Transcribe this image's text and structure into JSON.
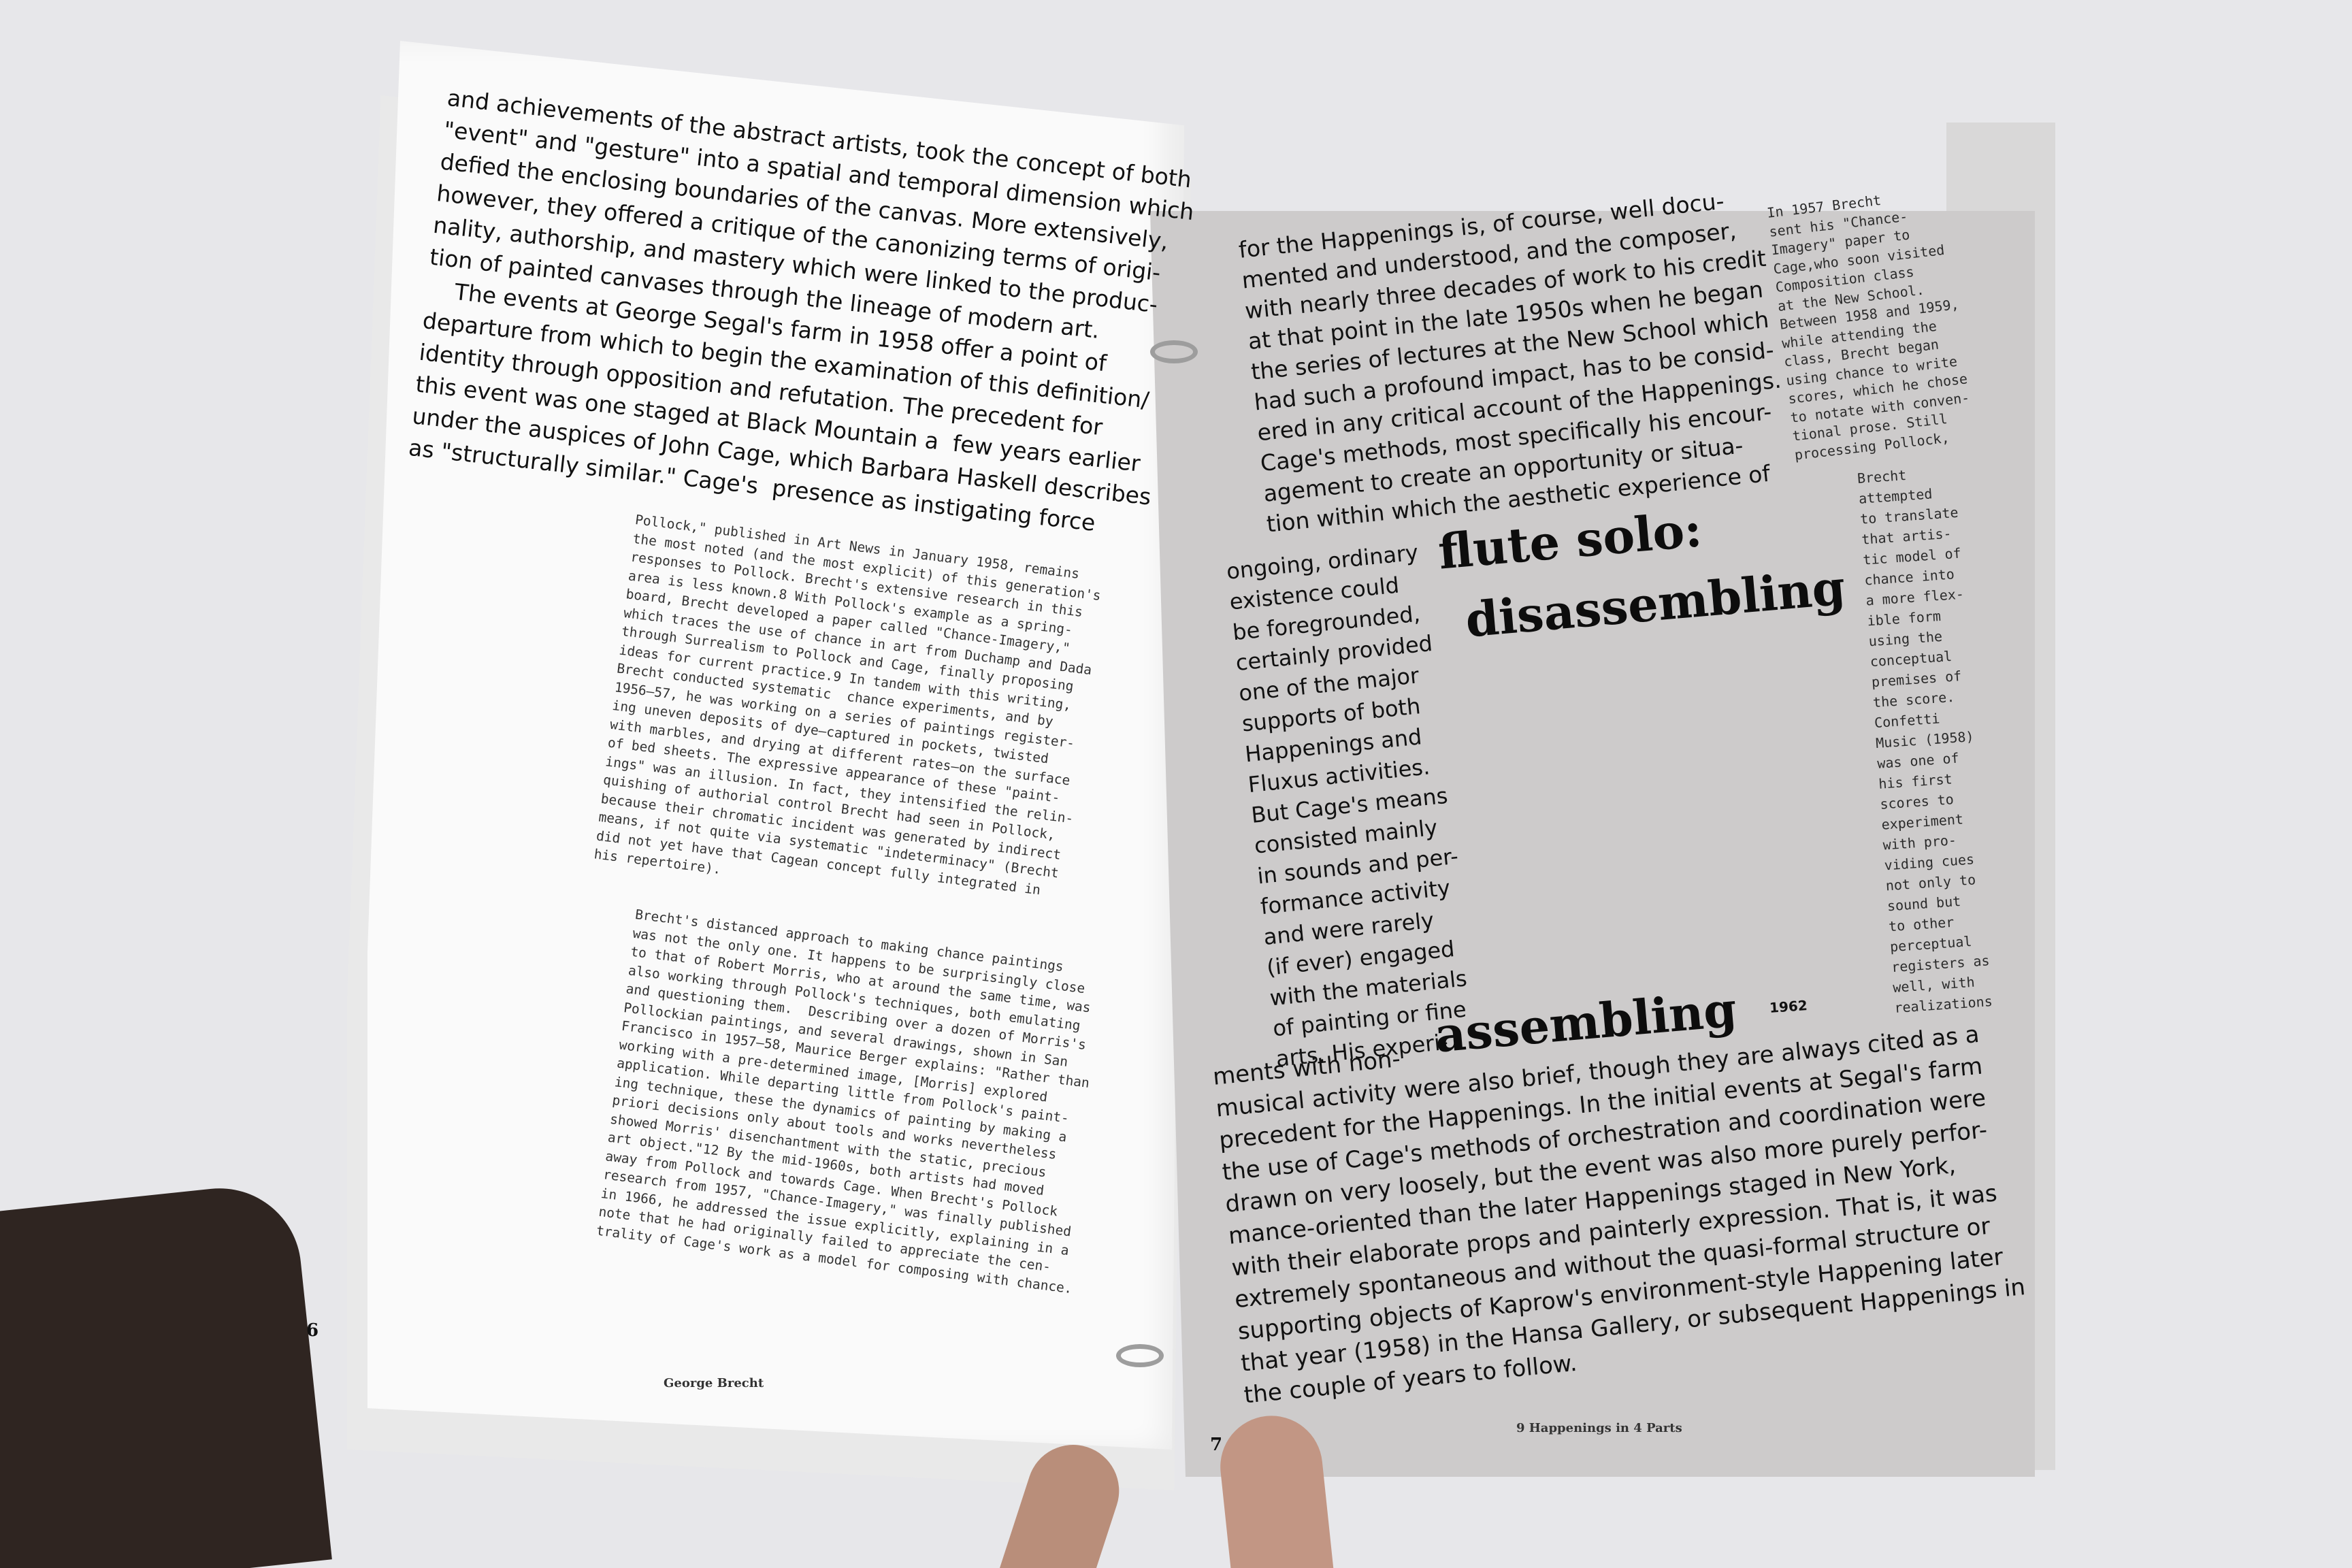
{
  "left_page": {
    "body_lines": [
      "and achievements of the abstract artists, took the concept of both",
      "\"event\" and \"gesture\" into a spatial and temporal dimension which",
      "defied the enclosing boundaries of the canvas. More extensively,",
      "however, they offered a critique of the canonizing terms of origi-",
      "nality, authorship, and mastery which were linked to the produc-",
      "tion of painted canvases through the lineage of modern art.",
      "    The events at George Segal's farm in 1958 offer a point of",
      "departure from which to begin the examination of this definition/",
      "identity through opposition and refutation. The precedent for",
      "this event was one staged at Black Mountain a  few years earlier",
      "under the auspices of John Cage, which Barbara Haskell describes",
      "as \"structurally similar.\" Cage's  presence as instigating force"
    ],
    "mono_block_1": [
      "Pollock,\" published in Art News in January 1958, remains",
      "the most noted (and the most explicit) of this generation's",
      "responses to Pollock. Brecht's extensive research in this",
      "area is less known.8 With Pollock's example as a spring-",
      "board, Brecht developed a paper called \"Chance-Imagery,\"",
      "which traces the use of chance in art from Duchamp and Dada",
      "through Surrealism to Pollock and Cage, finally proposing",
      "ideas for current practice.9 In tandem with this writing,",
      "Brecht conducted systematic  chance experiments, and by",
      "1956–57, he was working on a series of paintings register-",
      "ing uneven deposits of dye–captured in pockets, twisted",
      "with marbles, and drying at different rates–on the surface",
      "of bed sheets. The expressive appearance of these \"paint-",
      "ings\" was an illusion. In fact, they intensified the relin-",
      "quishing of authorial control Brecht had seen in Pollock,",
      "because their chromatic incident was generated by indirect",
      "means, if not quite via systematic \"indeterminacy\" (Brecht",
      "did not yet have that Cagean concept fully integrated in",
      "his repertoire)."
    ],
    "mono_block_2": [
      "Brecht's distanced approach to making chance paintings",
      "was not the only one. It happens to be surprisingly close",
      "to that of Robert Morris, who at around the same time, was",
      "also working through Pollock's techniques, both emulating",
      "and questioning them.  Describing over a dozen of Morris's",
      "Pollockian paintings, and several drawings, shown in San",
      "Francisco in 1957–58, Maurice Berger explains: \"Rather than",
      "working with a pre-determined image, [Morris] explored",
      "application. While departing little from Pollock's paint-",
      "ing technique, these the dynamics of painting by making a",
      "priori decisions only about tools and works nevertheless",
      "showed Morris' disenchantment with the static, precious",
      "art object.\"12 By the mid-1960s, both artists had moved",
      "away from Pollock and towards Cage. When Brecht's Pollock",
      "research from 1957, \"Chance-Imagery,\" was finally published",
      "in 1966, he addressed the issue explicitly, explaining in a",
      "note that he had originally failed to appreciate the cen-",
      "trality of Cage's work as a model for composing with chance."
    ],
    "page_number": "6",
    "footer": "George Brecht"
  },
  "right_page": {
    "body_lines": [
      "for the Happenings is, of course, well docu-",
      "mented and understood, and the composer,",
      "with nearly three decades of work to his credit",
      "at that point in the late 1950s when he began",
      "the series of lectures at the New School which",
      "had such a profound impact, has to be consid-",
      "ered in any critical account of the Happenings.",
      "Cage's methods, most specifically his encour-",
      "agement to create an opportunity or situa-",
      "tion within which the aesthetic experience of"
    ],
    "narrow_lines": [
      "ongoing, ordinary",
      "existence could",
      "be foregrounded,",
      "certainly provided",
      "one of the major",
      "supports of both",
      "Happenings and",
      "Fluxus activities.",
      "But Cage's means",
      "consisted mainly",
      "in sounds and per-",
      "formance activity",
      "and were rarely",
      "(if ever) engaged",
      "with the materials",
      "of painting or fine",
      "arts. His experi-"
    ],
    "bottom_lines": [
      "ments with non-",
      "musical activity were also brief, though they are always cited as a",
      "precedent for the Happenings. In the initial events at Segal's farm",
      "the use of Cage's methods of orchestration and coordination were",
      "drawn on very loosely, but the event was also more purely perfor-",
      "mance-oriented than the later Happenings staged in New York,",
      "with their elaborate props and painterly expression. That is, it was",
      "extremely spontaneous and without the quasi-formal structure or",
      "supporting objects of Kaprow's environment-style Happening later",
      "that year (1958) in the Hansa Gallery, or subsequent Happenings in",
      "the couple of years to follow."
    ],
    "heading_1": "flute solo:",
    "heading_2": "disassembling",
    "heading_3": "assembling",
    "year": "1962",
    "mono_block_1": [
      "In 1957 Brecht",
      "sent his \"Chance-",
      "Imagery\" paper to",
      "Cage,who soon visited",
      "Composition class",
      "at the New School.",
      "Between 1958 and 1959,",
      "while attending the",
      "class, Brecht began",
      "using chance to write",
      "scores, which he chose",
      "to notate with conven-",
      "tional prose. Still",
      "processing Pollock,"
    ],
    "mono_block_2": [
      "Brecht",
      "attempted",
      "to translate",
      "that artis-",
      "tic model of",
      "chance into",
      "a more flex-",
      "ible form",
      "using the",
      "conceptual",
      "premises of",
      "the score.",
      "Confetti",
      "Music (1958)",
      "was one of",
      "his first",
      "scores to",
      "experiment",
      "with pro-",
      "viding cues",
      "not only to",
      "sound but",
      "to other",
      "perceptual",
      "registers as",
      "well, with",
      "realizations"
    ],
    "page_number": "7",
    "footer": "9 Happenings in 4 Parts"
  }
}
